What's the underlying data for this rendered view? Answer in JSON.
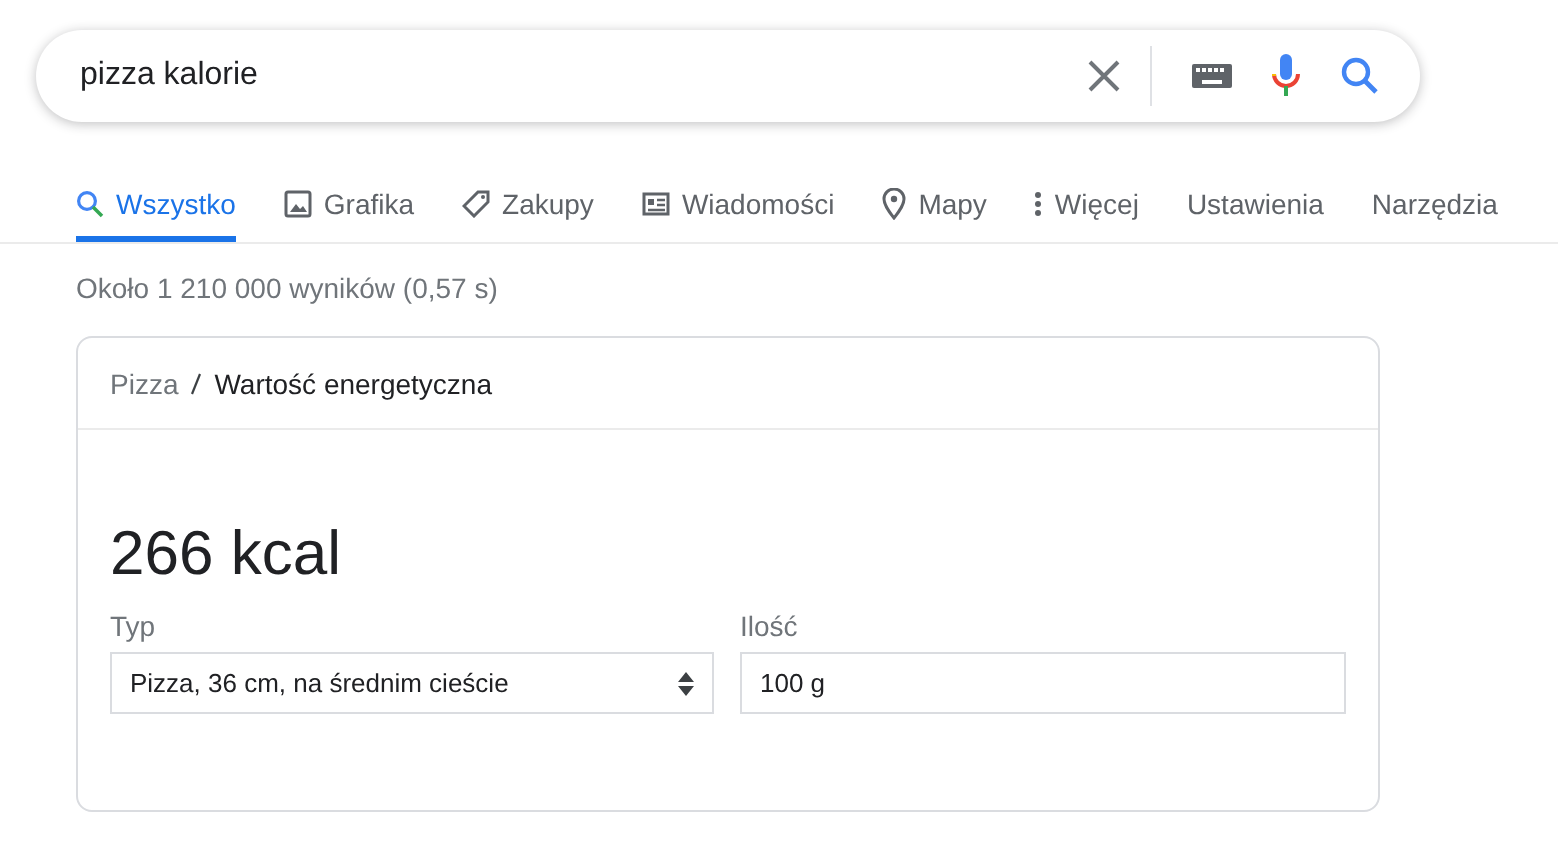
{
  "search": {
    "value": "pizza kalorie"
  },
  "tabs": [
    {
      "label": "Wszystko",
      "selected": true
    },
    {
      "label": "Grafika",
      "selected": false
    },
    {
      "label": "Zakupy",
      "selected": false
    },
    {
      "label": "Wiadomości",
      "selected": false
    },
    {
      "label": "Mapy",
      "selected": false
    },
    {
      "label": "Więcej",
      "selected": false
    },
    {
      "label": "Ustawienia",
      "selected": false
    },
    {
      "label": "Narzędzia",
      "selected": false
    }
  ],
  "result_stats": "Około 1 210 000 wyników (0,57 s)",
  "card": {
    "breadcrumb": [
      "Pizza",
      "Wartość energetyczna"
    ],
    "value": "266 kcal",
    "fields": [
      {
        "kind": "select",
        "label": "Typ",
        "value": "Pizza, 36 cm, na średnim cieście"
      },
      {
        "kind": "input",
        "label": "Ilość",
        "value": "100 g"
      }
    ]
  }
}
